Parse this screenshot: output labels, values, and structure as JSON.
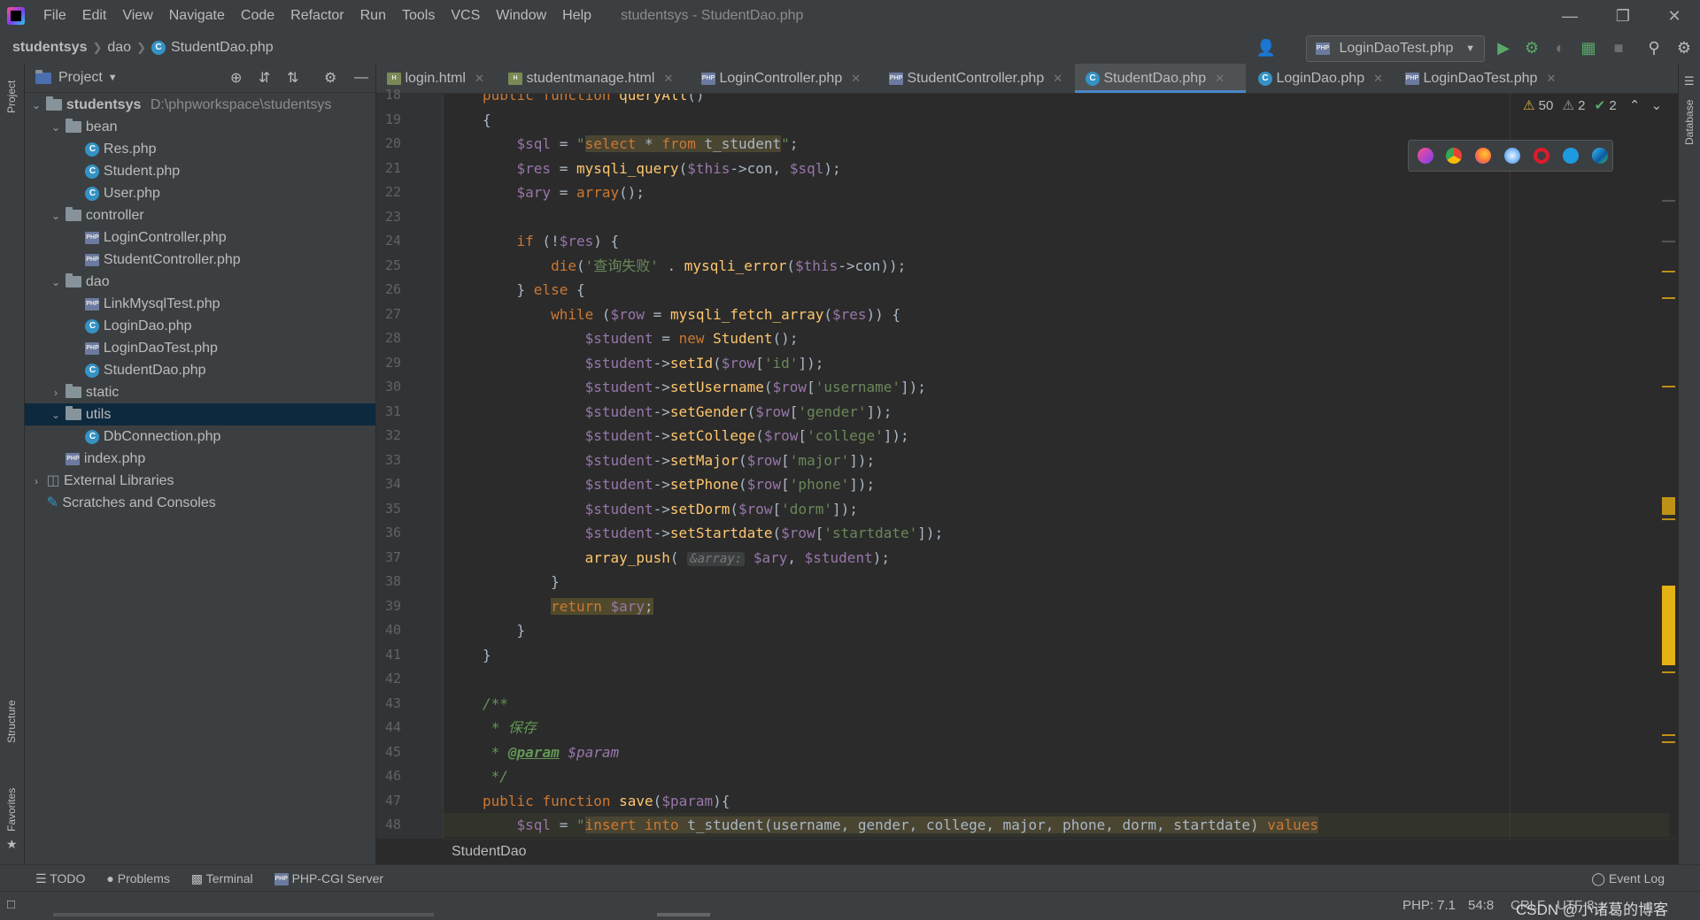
{
  "menu": [
    "File",
    "Edit",
    "View",
    "Navigate",
    "Code",
    "Refactor",
    "Run",
    "Tools",
    "VCS",
    "Window",
    "Help"
  ],
  "window_title": "studentsys - StudentDao.php",
  "breadcrumb": [
    "studentsys",
    "dao",
    "StudentDao.php"
  ],
  "run_config": "LoginDaoTest.php",
  "project_panel": {
    "title": "Project",
    "tree": [
      {
        "label": "studentsys",
        "path": "D:\\phpworkspace\\studentsys",
        "type": "root",
        "depth": 0,
        "arrow": "down"
      },
      {
        "label": "bean",
        "type": "folder",
        "depth": 1,
        "arrow": "down"
      },
      {
        "label": "Res.php",
        "type": "class",
        "depth": 2
      },
      {
        "label": "Student.php",
        "type": "class",
        "depth": 2
      },
      {
        "label": "User.php",
        "type": "class",
        "depth": 2
      },
      {
        "label": "controller",
        "type": "folder",
        "depth": 1,
        "arrow": "down"
      },
      {
        "label": "LoginController.php",
        "type": "php",
        "depth": 2
      },
      {
        "label": "StudentController.php",
        "type": "php",
        "depth": 2
      },
      {
        "label": "dao",
        "type": "folder",
        "depth": 1,
        "arrow": "down"
      },
      {
        "label": "LinkMysqlTest.php",
        "type": "php",
        "depth": 2
      },
      {
        "label": "LoginDao.php",
        "type": "class",
        "depth": 2
      },
      {
        "label": "LoginDaoTest.php",
        "type": "php",
        "depth": 2
      },
      {
        "label": "StudentDao.php",
        "type": "class",
        "depth": 2
      },
      {
        "label": "static",
        "type": "folder",
        "depth": 1,
        "arrow": "right"
      },
      {
        "label": "utils",
        "type": "folder",
        "depth": 1,
        "arrow": "down",
        "selected": true
      },
      {
        "label": "DbConnection.php",
        "type": "class",
        "depth": 2
      },
      {
        "label": "index.php",
        "type": "php",
        "depth": 1
      },
      {
        "label": "External Libraries",
        "type": "lib",
        "depth": 0,
        "arrow": "right"
      },
      {
        "label": "Scratches and Consoles",
        "type": "scratch",
        "depth": 0
      }
    ]
  },
  "tabs": [
    {
      "label": "login.html",
      "icon": "html"
    },
    {
      "label": "studentmanage.html",
      "icon": "html"
    },
    {
      "label": "LoginController.php",
      "icon": "php"
    },
    {
      "label": "StudentController.php",
      "icon": "php"
    },
    {
      "label": "StudentDao.php",
      "icon": "class",
      "active": true
    },
    {
      "label": "LoginDao.php",
      "icon": "class"
    },
    {
      "label": "LoginDaoTest.php",
      "icon": "php"
    }
  ],
  "inspections": {
    "warnings": "50",
    "weak_warnings": "2",
    "ok": "2"
  },
  "code_lines": [
    {
      "n": "18",
      "text": "public function queryAll()"
    },
    {
      "n": "19",
      "text": "{"
    },
    {
      "n": "20",
      "text": "    $sql = \"select * from t_student\";"
    },
    {
      "n": "21",
      "text": "    $res = mysqli_query($this->con, $sql);"
    },
    {
      "n": "22",
      "text": "    $ary = array();"
    },
    {
      "n": "23",
      "text": ""
    },
    {
      "n": "24",
      "text": "    if (!$res) {"
    },
    {
      "n": "25",
      "text": "        die('查询失败' . mysqli_error($this->con));"
    },
    {
      "n": "26",
      "text": "    } else {"
    },
    {
      "n": "27",
      "text": "        while ($row = mysqli_fetch_array($res)) {"
    },
    {
      "n": "28",
      "text": "            $student = new Student();"
    },
    {
      "n": "29",
      "text": "            $student->setId($row['id']);"
    },
    {
      "n": "30",
      "text": "            $student->setUsername($row['username']);"
    },
    {
      "n": "31",
      "text": "            $student->setGender($row['gender']);"
    },
    {
      "n": "32",
      "text": "            $student->setCollege($row['college']);"
    },
    {
      "n": "33",
      "text": "            $student->setMajor($row['major']);"
    },
    {
      "n": "34",
      "text": "            $student->setPhone($row['phone']);"
    },
    {
      "n": "35",
      "text": "            $student->setDorm($row['dorm']);"
    },
    {
      "n": "36",
      "text": "            $student->setStartdate($row['startdate']);"
    },
    {
      "n": "37",
      "text": "            array_push( &array: $ary, $student);"
    },
    {
      "n": "38",
      "text": "        }"
    },
    {
      "n": "39",
      "text": "        return $ary;"
    },
    {
      "n": "40",
      "text": "    }"
    },
    {
      "n": "41",
      "text": "}"
    },
    {
      "n": "42",
      "text": ""
    },
    {
      "n": "43",
      "text": "/**"
    },
    {
      "n": "44",
      "text": " * 保存"
    },
    {
      "n": "45",
      "text": " * @param $param"
    },
    {
      "n": "46",
      "text": " */"
    },
    {
      "n": "47",
      "text": "public function save($param){"
    },
    {
      "n": "48",
      "text": "    $sql = \"insert into t_student(username, gender, college, major, phone, dorm, startdate) values"
    }
  ],
  "editor_breadcrumb": "StudentDao",
  "bottom_tools": [
    "TODO",
    "Problems",
    "Terminal",
    "PHP-CGI Server"
  ],
  "event_log": "Event Log",
  "status": {
    "php_version": "PHP: 7.1",
    "position": "54:8",
    "encoding": "CRLF",
    "charset": "UTF-8",
    "watermark": "CSDN @小诸葛的博客"
  },
  "side_tabs": {
    "left": [
      "Project",
      "Structure",
      "Favorites"
    ],
    "right": [
      "Database"
    ]
  },
  "colors": {
    "bg": "#2b2b2b",
    "panel": "#3c3f41",
    "keyword": "#cc7832",
    "string": "#6a8759",
    "variable": "#9876aa",
    "function": "#ffc66d",
    "selection": "#0d293e",
    "tab_accent": "#4a88c7"
  }
}
